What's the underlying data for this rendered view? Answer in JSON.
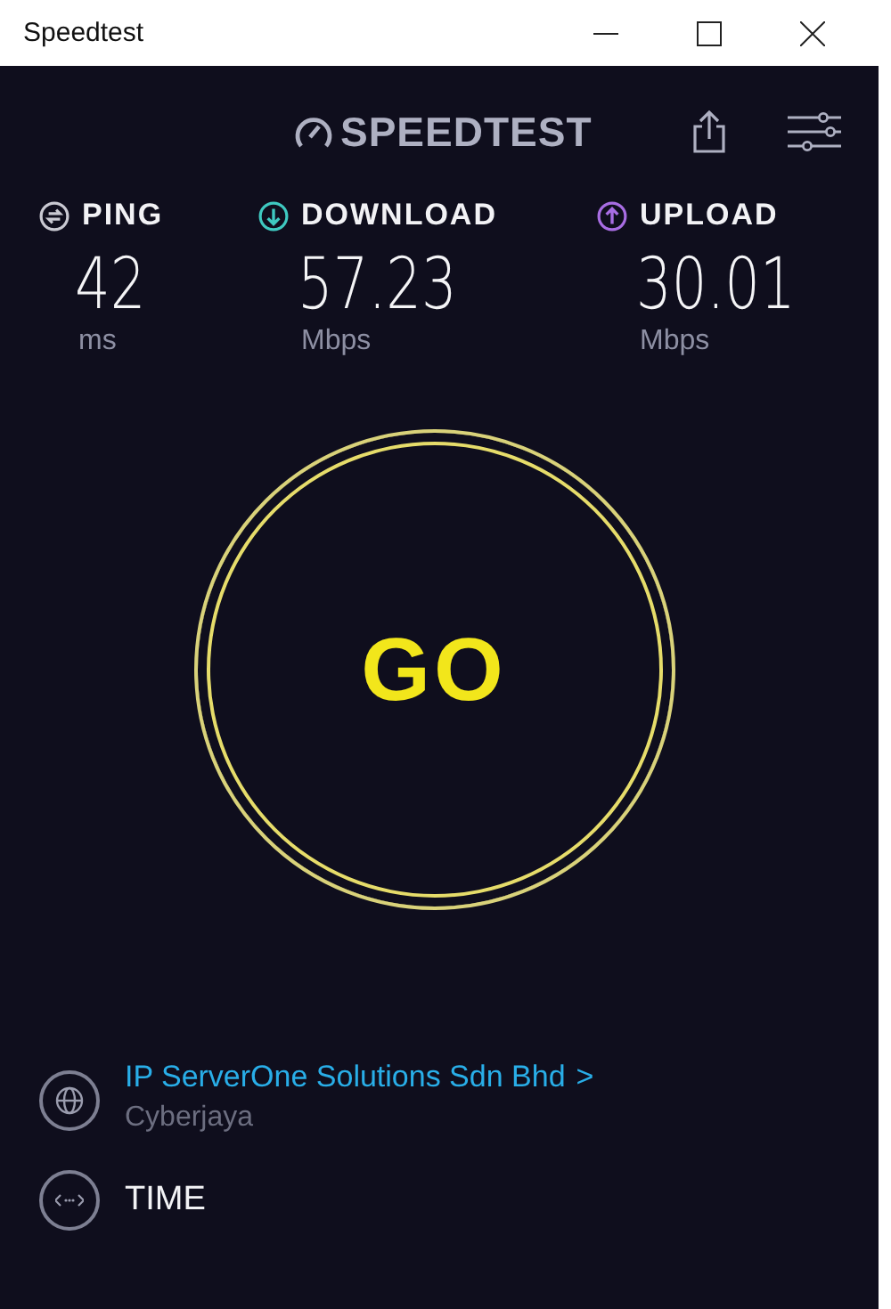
{
  "window": {
    "title": "Speedtest"
  },
  "header": {
    "logo": "SPEEDTEST"
  },
  "metrics": [
    {
      "kind": "ping",
      "label": "PING",
      "value": "42",
      "unit": "ms",
      "color": "#c9c9d2"
    },
    {
      "kind": "download",
      "label": "DOWNLOAD",
      "value": "57.23",
      "unit": "Mbps",
      "color": "#3fc9c1"
    },
    {
      "kind": "upload",
      "label": "UPLOAD",
      "value": "30.01",
      "unit": "Mbps",
      "color": "#a86de3"
    }
  ],
  "go_button": {
    "label": "GO"
  },
  "server": {
    "name": "IP ServerOne Solutions Sdn Bhd",
    "chevron": ">",
    "location": "Cyberjaya"
  },
  "connection": {
    "label": "TIME"
  }
}
